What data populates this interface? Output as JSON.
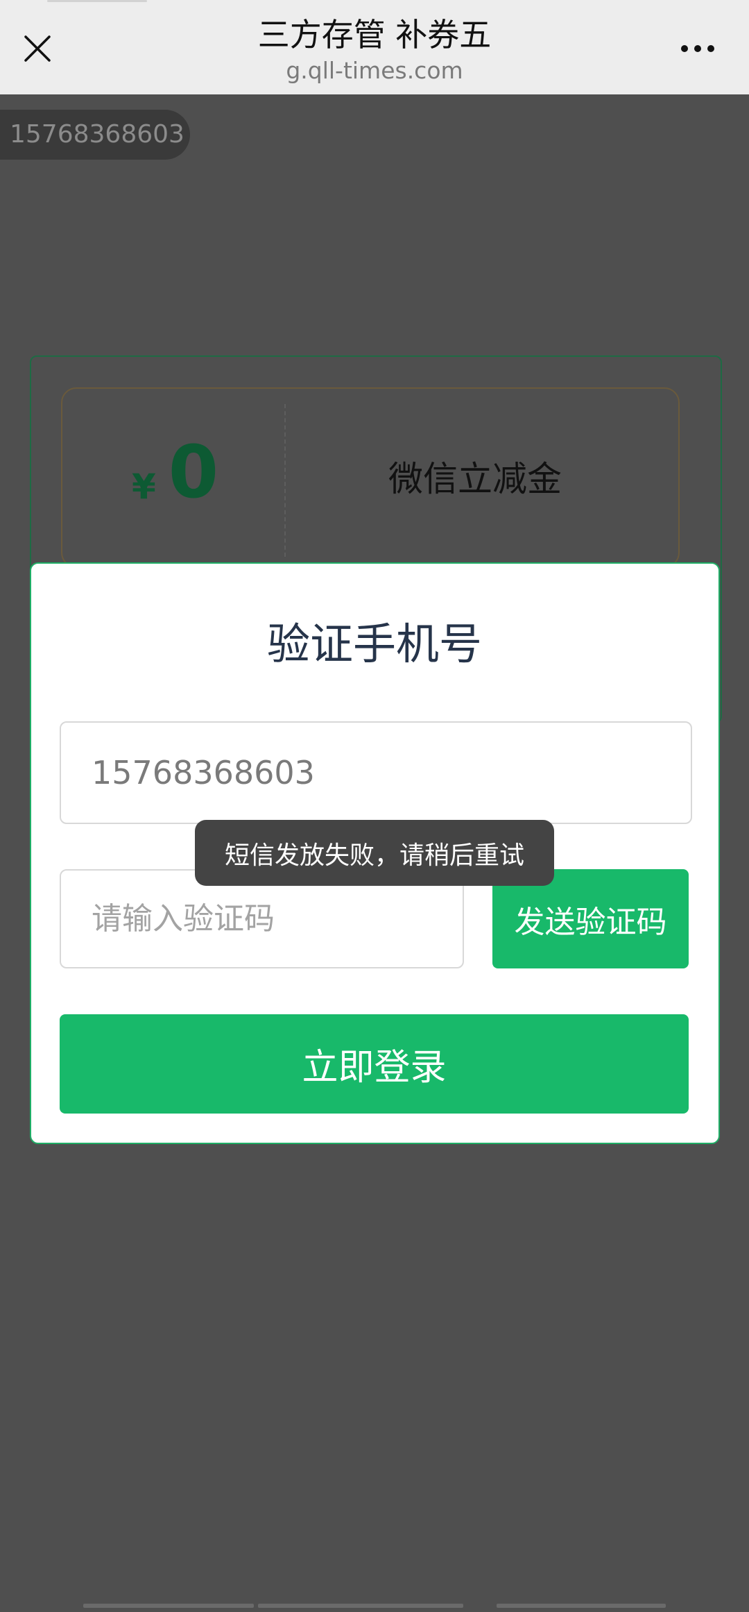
{
  "nav": {
    "title": "三方存管 补券五",
    "url": "g.qll-times.com"
  },
  "user": {
    "phone_pill": "15768368603"
  },
  "coupon": {
    "currency": "¥",
    "amount": "0",
    "label": "微信立减金"
  },
  "modal": {
    "title": "验证手机号",
    "phone_value": "15768368603",
    "code_placeholder": "请输入验证码",
    "send_code_label": "发送验证码",
    "login_label": "立即登录"
  },
  "toast": {
    "message": "短信发放失败，请稍后重试"
  },
  "colors": {
    "accent": "#18b96a",
    "overlay": "#4f4f4f",
    "coupon_green": "#0d5a33"
  }
}
